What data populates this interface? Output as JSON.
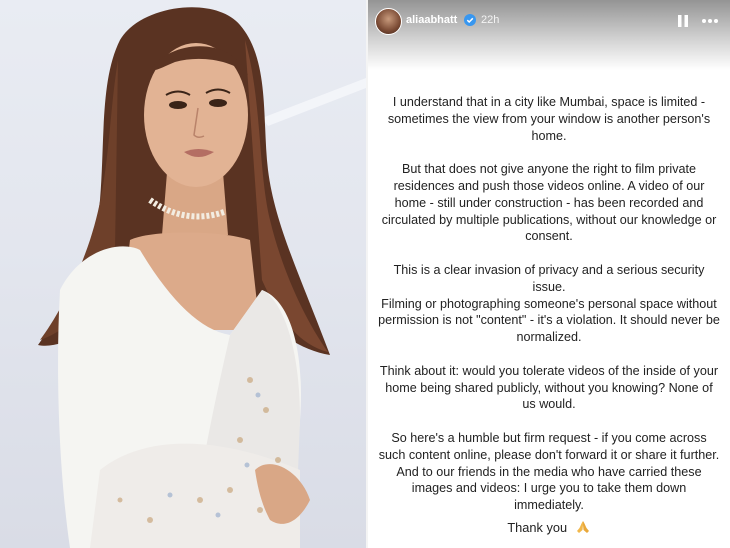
{
  "story": {
    "username": "aliaabhatt",
    "time": "22h",
    "paragraphs": [
      "I understand that in a city like Mumbai, space is limited - sometimes the view from your window is another person's home.",
      "But that does not give anyone the right to film private residences and push those videos online. A video of our home - still under construction - has been recorded and circulated by multiple publications, without our knowledge or consent.",
      "This is a clear invasion of privacy and a serious security issue.",
      "Filming or photographing someone's personal space without permission is not \"content\" - it's a violation. It should never be normalized.",
      "Think about it: would you tolerate videos of the inside of your home being shared publicly, without you knowing? None of us would.",
      "So here's a humble but firm request - if you come across such content online, please don't forward it or share it further. And to our friends in the media who have carried these images and videos: I urge you to take them down immediately."
    ],
    "thanks": "Thank you"
  },
  "icons": {
    "verified": "verified-badge-icon",
    "pause": "pause-icon",
    "more": "more-options-icon",
    "pray": "folded-hands-emoji"
  },
  "colors": {
    "text": "#222222",
    "verified": "#3897f0",
    "photo_background": "#e6e9f1"
  }
}
